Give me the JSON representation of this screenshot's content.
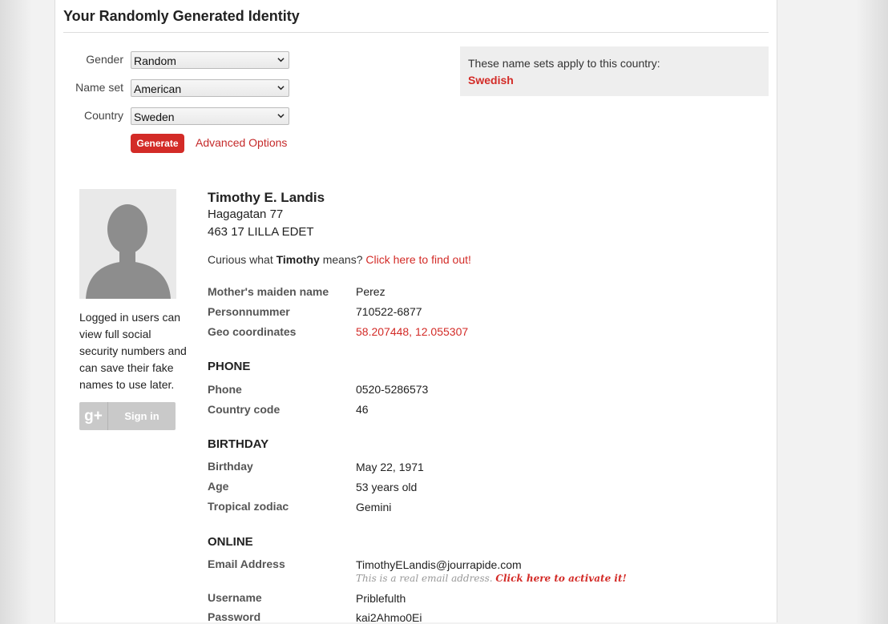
{
  "header": {
    "title": "Your Randomly Generated Identity"
  },
  "form": {
    "gender_label": "Gender",
    "gender_value": "Random",
    "nameset_label": "Name set",
    "nameset_value": "American",
    "country_label": "Country",
    "country_value": "Sweden",
    "generate_label": "Generate",
    "advanced_label": "Advanced Options"
  },
  "nameset_info": {
    "text": "These name sets apply to this country:",
    "link": "Swedish"
  },
  "sidebar": {
    "login_note": "Logged in users can view full social security numbers and can save their fake names to use later.",
    "signin_label": "Sign in",
    "gplus_glyph": "g+"
  },
  "identity": {
    "name": "Timothy E. Landis",
    "address_line1": "Hagagatan 77",
    "address_line2": "463 17  LILLA EDET",
    "curious_prefix": "Curious what",
    "first_name": "Timothy",
    "curious_suffix": "means?",
    "curious_link": "Click here to find out!",
    "mothers_maiden_label": "Mother's maiden name",
    "mothers_maiden_value": "Perez",
    "personnummer_label": "Personnummer",
    "personnummer_value": "710522-6877",
    "geo_label": "Geo coordinates",
    "geo_value": "58.207448, 12.055307"
  },
  "phone": {
    "heading": "PHONE",
    "phone_label": "Phone",
    "phone_value": "0520-5286573",
    "cc_label": "Country code",
    "cc_value": "46"
  },
  "birthday": {
    "heading": "BIRTHDAY",
    "birthday_label": "Birthday",
    "birthday_value": "May 22, 1971",
    "age_label": "Age",
    "age_value": "53 years old",
    "zodiac_label": "Tropical zodiac",
    "zodiac_value": "Gemini"
  },
  "online": {
    "heading": "ONLINE",
    "email_label": "Email Address",
    "email_value": "TimothyELandis@jourrapide.com",
    "email_note": "This is a real email address.",
    "email_activate": "Click here to activate it!",
    "username_label": "Username",
    "username_value": "Priblefulth",
    "password_label": "Password",
    "password_value": "kai2Ahmo0Ei"
  },
  "colors": {
    "accent": "#d32b27",
    "nameset_bg": "#eeeeee"
  }
}
